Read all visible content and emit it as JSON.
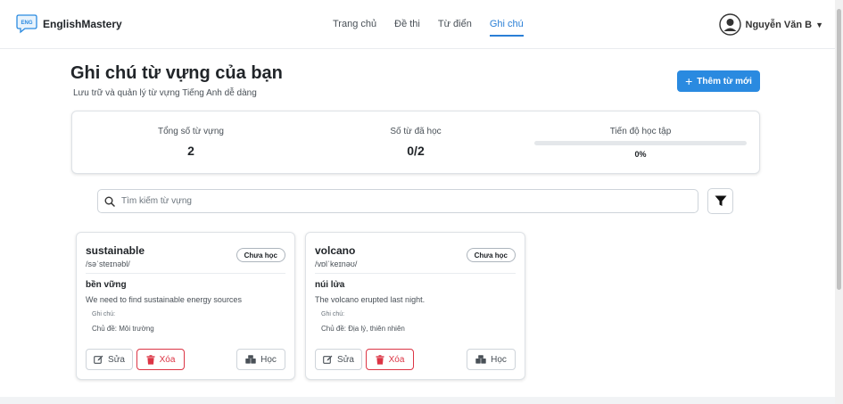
{
  "brand": {
    "logo_text": "ENG",
    "name": "EnglishMastery"
  },
  "nav": [
    {
      "label": "Trang chủ",
      "active": false
    },
    {
      "label": "Đề thi",
      "active": false
    },
    {
      "label": "Từ điển",
      "active": false
    },
    {
      "label": "Ghi chú",
      "active": true
    }
  ],
  "user": {
    "name": "Nguyễn Văn B",
    "caret": "▼"
  },
  "page": {
    "title": "Ghi chú từ vựng của bạn",
    "subtitle": "Lưu trữ và quản lý từ vựng Tiếng Anh dễ dàng",
    "add_button": "Thêm từ mới"
  },
  "stats": {
    "total_label": "Tổng số từ vựng",
    "total_value": "2",
    "learned_label": "Số từ đã học",
    "learned_value": "0/2",
    "progress_label": "Tiến độ học tập",
    "progress_text": "0%",
    "progress_fraction": 0
  },
  "search": {
    "placeholder": "Tìm kiếm từ vựng",
    "value": ""
  },
  "cards": [
    {
      "word": "sustainable",
      "phonetic": "/səˈsteɪnəbl/",
      "status": "Chưa học",
      "meaning": "bền vững",
      "example": "We need to find sustainable energy sources",
      "note_label": "Ghi chú:",
      "note": "Chủ đề: Môi trường",
      "edit": "Sửa",
      "delete": "Xóa",
      "learn": "Học"
    },
    {
      "word": "volcano",
      "phonetic": "/vɒlˈkeɪnəʊ/",
      "status": "Chưa học",
      "meaning": "núi lửa",
      "example": "The volcano erupted last night.",
      "note_label": "Ghi chú:",
      "note": "Chủ đề: Địa lý, thiên nhiên",
      "edit": "Sửa",
      "delete": "Xóa",
      "learn": "Học"
    }
  ],
  "colors": {
    "accent": "#2a8ae0",
    "danger": "#dc3545"
  },
  "icons": [
    "chat-bubble-logo-icon",
    "user-avatar-icon",
    "plus-icon",
    "search-icon",
    "filter-icon",
    "edit-icon",
    "trash-icon",
    "book-icon"
  ]
}
